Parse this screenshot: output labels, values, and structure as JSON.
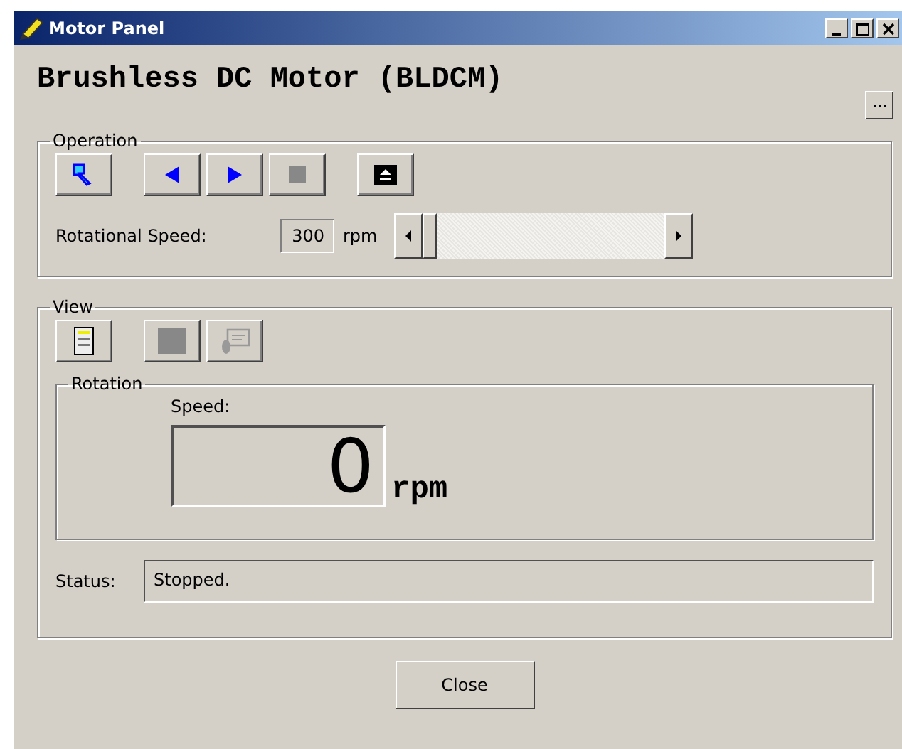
{
  "window": {
    "title": "Motor Panel"
  },
  "heading": "Brushless DC Motor (BLDCM)",
  "operation": {
    "label": "Operation",
    "buttons": [
      {
        "disabled": false
      },
      {
        "disabled": false
      },
      {
        "disabled": false
      },
      {
        "disabled": true
      },
      {
        "disabled": false
      }
    ],
    "speed_label": "Rotational Speed:",
    "speed_value": "300",
    "speed_unit": "rpm",
    "slider": {
      "level": 0
    }
  },
  "view": {
    "label": "View",
    "buttons": [
      {
        "disabled": false
      },
      {
        "disabled": true
      },
      {
        "disabled": true
      }
    ],
    "rotation": {
      "label": "Rotation",
      "speed_label": "Speed:",
      "speed_value": "0",
      "speed_unit": "rpm"
    },
    "status_label": "Status:",
    "status_value": "Stopped."
  },
  "buttons": [
    "Close"
  ]
}
